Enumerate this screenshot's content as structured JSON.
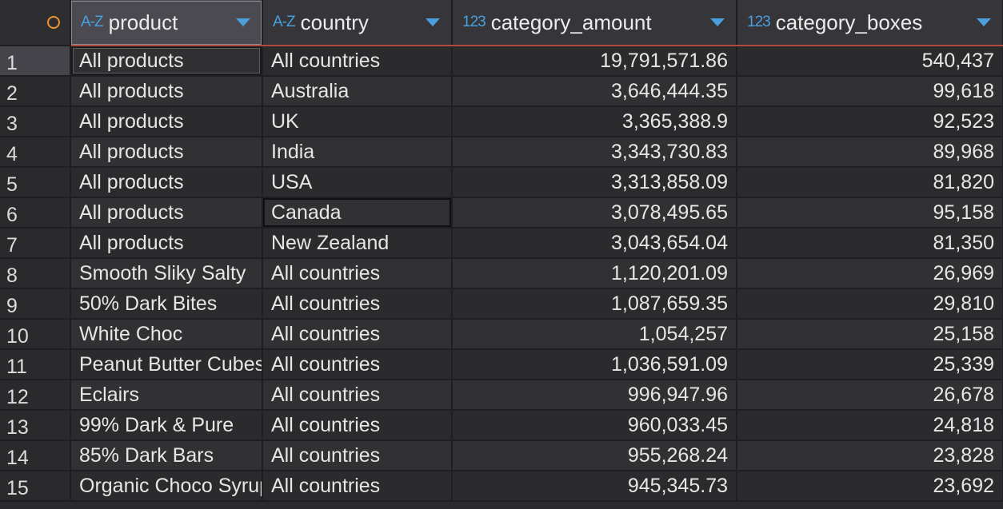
{
  "columns": {
    "product": {
      "type_icon": "A-Z",
      "label": "product"
    },
    "country": {
      "type_icon": "A-Z",
      "label": "country"
    },
    "category_amount": {
      "type_icon": "123",
      "label": "category_amount"
    },
    "category_boxes": {
      "type_icon": "123",
      "label": "category_boxes"
    }
  },
  "rows": [
    {
      "n": "1",
      "product": "All products",
      "country": "All countries",
      "amount": "19,791,571.86",
      "boxes": "540,437"
    },
    {
      "n": "2",
      "product": "All products",
      "country": "Australia",
      "amount": "3,646,444.35",
      "boxes": "99,618"
    },
    {
      "n": "3",
      "product": "All products",
      "country": "UK",
      "amount": "3,365,388.9",
      "boxes": "92,523"
    },
    {
      "n": "4",
      "product": "All products",
      "country": "India",
      "amount": "3,343,730.83",
      "boxes": "89,968"
    },
    {
      "n": "5",
      "product": "All products",
      "country": "USA",
      "amount": "3,313,858.09",
      "boxes": "81,820"
    },
    {
      "n": "6",
      "product": "All products",
      "country": "Canada",
      "amount": "3,078,495.65",
      "boxes": "95,158"
    },
    {
      "n": "7",
      "product": "All products",
      "country": "New Zealand",
      "amount": "3,043,654.04",
      "boxes": "81,350"
    },
    {
      "n": "8",
      "product": "Smooth Sliky Salty",
      "country": "All countries",
      "amount": "1,120,201.09",
      "boxes": "26,969"
    },
    {
      "n": "9",
      "product": "50% Dark Bites",
      "country": "All countries",
      "amount": "1,087,659.35",
      "boxes": "29,810"
    },
    {
      "n": "10",
      "product": "White Choc",
      "country": "All countries",
      "amount": "1,054,257",
      "boxes": "25,158"
    },
    {
      "n": "11",
      "product": "Peanut Butter Cubes",
      "country": "All countries",
      "amount": "1,036,591.09",
      "boxes": "25,339"
    },
    {
      "n": "12",
      "product": "Eclairs",
      "country": "All countries",
      "amount": "996,947.96",
      "boxes": "26,678"
    },
    {
      "n": "13",
      "product": "99% Dark & Pure",
      "country": "All countries",
      "amount": "960,033.45",
      "boxes": "24,818"
    },
    {
      "n": "14",
      "product": "85% Dark Bars",
      "country": "All countries",
      "amount": "955,268.24",
      "boxes": "23,828"
    },
    {
      "n": "15",
      "product": "Organic Choco Syrup",
      "country": "All countries",
      "amount": "945,345.73",
      "boxes": "23,692"
    }
  ],
  "colors": {
    "accent": "#4a9fde",
    "header_underline": "#b04a3c",
    "corner_circle": "#e8952f"
  }
}
